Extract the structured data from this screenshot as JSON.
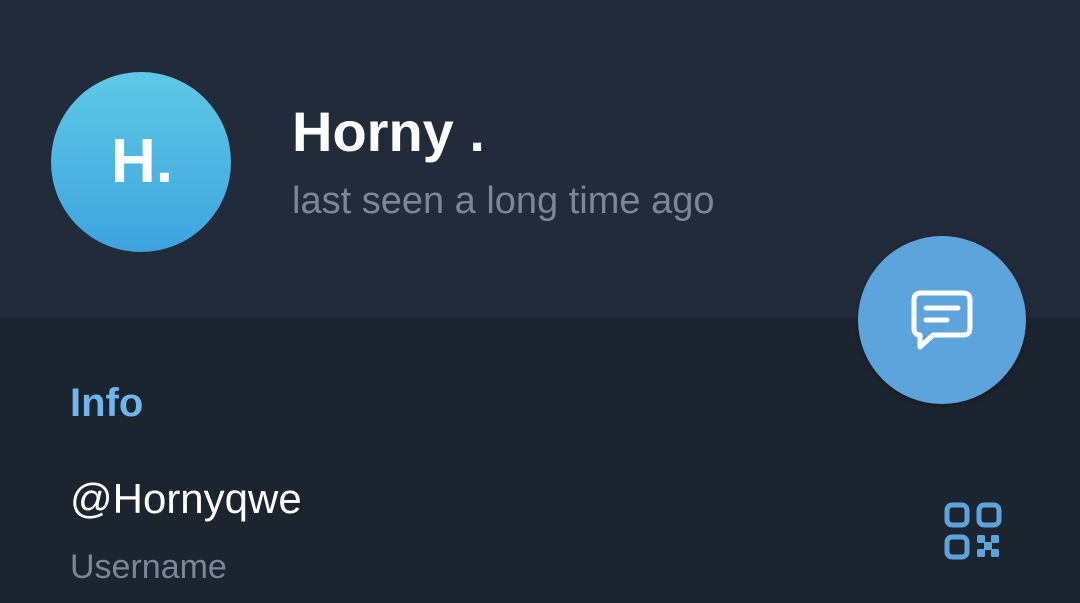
{
  "profile": {
    "avatar_initials": "H.",
    "name": "Horny .",
    "status": "last seen a long time ago"
  },
  "info": {
    "section_title": "Info",
    "username_value": "@Hornyqwe",
    "username_caption": "Username"
  },
  "icons": {
    "fab": "message-icon",
    "username_action": "qr-code-icon"
  },
  "colors": {
    "header_bg": "#222b39",
    "body_bg": "#1c242f",
    "accent": "#5da4dd",
    "section_title": "#6fb5ee",
    "secondary_text": "#7b8797"
  }
}
